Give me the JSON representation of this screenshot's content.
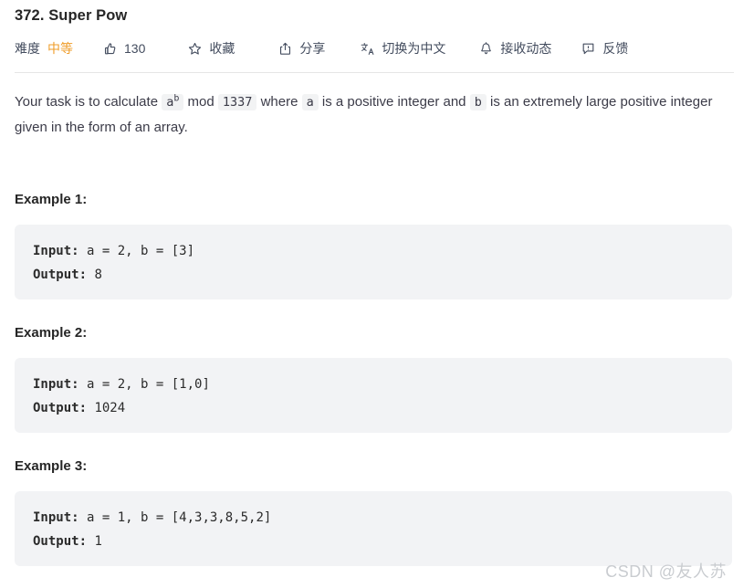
{
  "header": {
    "title": "372. Super Pow",
    "difficulty_label": "难度",
    "difficulty_value": "中等",
    "difficulty_color": "#ef9d2a"
  },
  "toolbar": {
    "like": {
      "icon": "thumbs-up-icon",
      "count": "130"
    },
    "favorite": {
      "icon": "star-icon",
      "label": "收藏"
    },
    "share": {
      "icon": "share-icon",
      "label": "分享"
    },
    "translate": {
      "icon": "translate-icon",
      "label": "切换为中文"
    },
    "subscribe": {
      "icon": "bell-icon",
      "label": "接收动态"
    },
    "feedback": {
      "icon": "feedback-icon",
      "label": "反馈"
    }
  },
  "description": {
    "part1": "Your task is to calculate ",
    "code_ab_base": "a",
    "code_ab_exp": "b",
    "part2": " mod ",
    "code_mod": "1337",
    "part3": " where ",
    "code_a": "a",
    "part4": " is a positive integer and ",
    "code_b": "b",
    "part5": " is an extremely large positive integer given in the form of an array."
  },
  "examples": [
    {
      "heading": "Example 1:",
      "input_key": "Input:",
      "input_value": " a = 2, b = [3]",
      "output_key": "Output:",
      "output_value": " 8"
    },
    {
      "heading": "Example 2:",
      "input_key": "Input:",
      "input_value": " a = 2, b = [1,0]",
      "output_key": "Output:",
      "output_value": " 1024"
    },
    {
      "heading": "Example 3:",
      "input_key": "Input:",
      "input_value": " a = 1, b = [4,3,3,8,5,2]",
      "output_key": "Output:",
      "output_value": " 1"
    }
  ],
  "watermark": "CSDN @友人苏"
}
